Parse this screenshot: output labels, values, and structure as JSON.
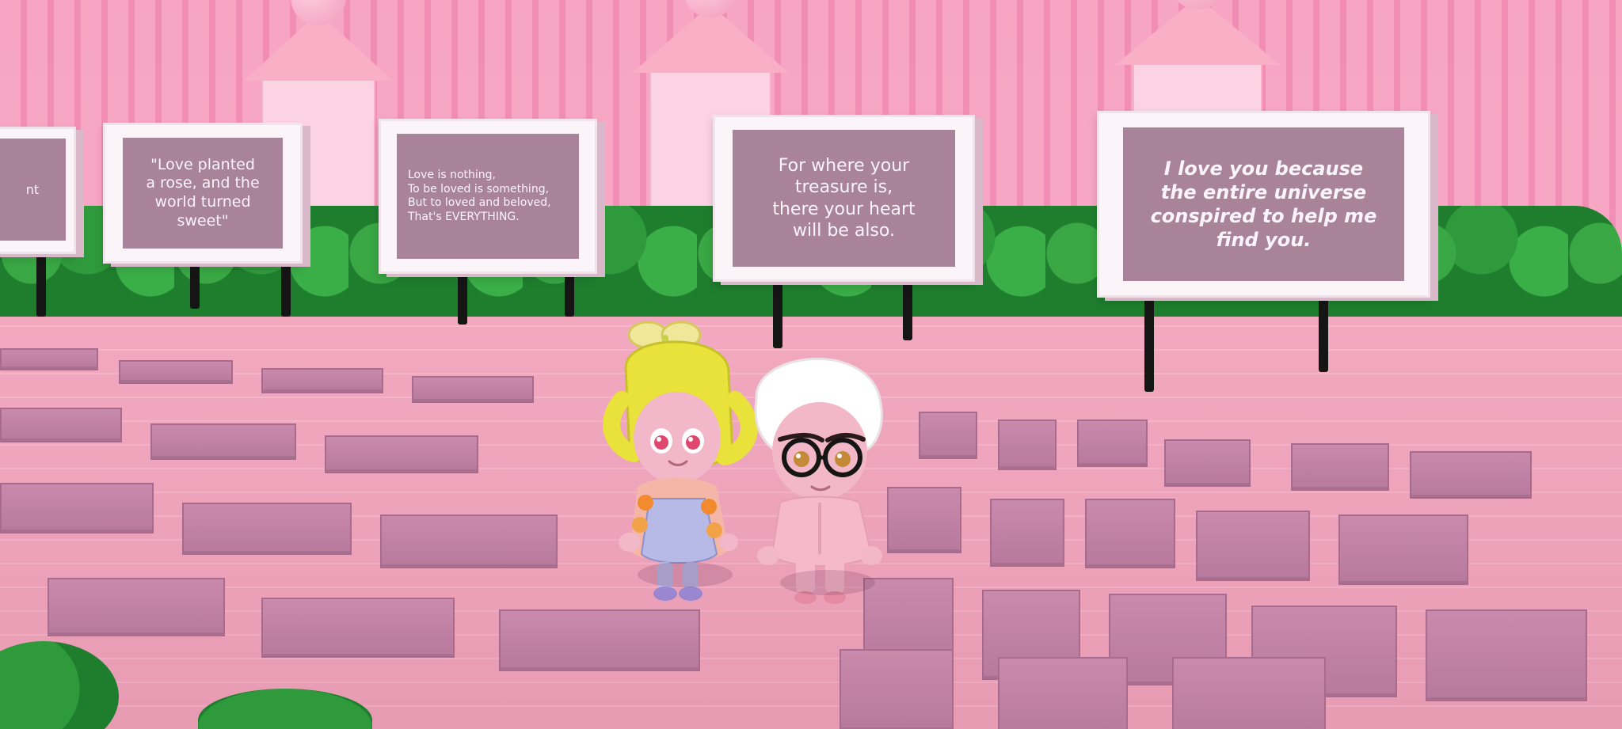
{
  "scene": {
    "signs": [
      {
        "id": "sign-left-edge",
        "text": "nt"
      },
      {
        "id": "sign-rose",
        "text": "\"Love planted\na rose, and the\nworld turned\nsweet\""
      },
      {
        "id": "sign-everything",
        "text": "Love is nothing,\nTo be loved is something,\nBut to loved and beloved,\nThat's EVERYTHING."
      },
      {
        "id": "sign-treasure",
        "text": "For where your\ntreasure is,\nthere your heart\nwill be also."
      },
      {
        "id": "sign-universe",
        "text": "I love you because\nthe entire universe\nconspired to help me\nfind you."
      }
    ],
    "characters": [
      {
        "id": "girl-avatar",
        "hair_color": "#e9e23a",
        "dress_color": "#b7b9e6"
      },
      {
        "id": "boy-avatar",
        "hair_color": "#ffffff",
        "suit_color": "#f6b9cb"
      }
    ]
  }
}
